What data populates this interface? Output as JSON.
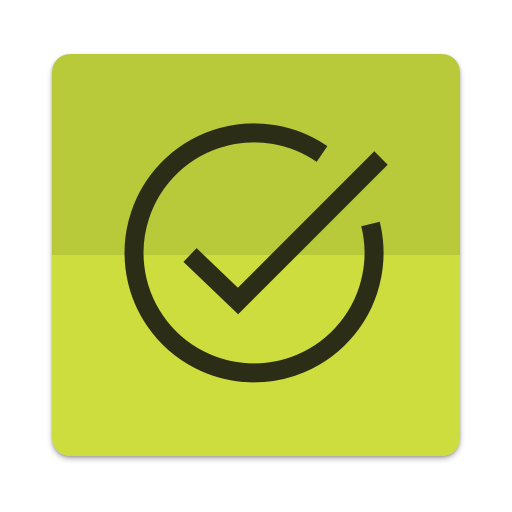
{
  "app_icon": {
    "icon_name": "check-circle-icon",
    "colors": {
      "background_top": "#b8c93a",
      "background_bottom": "#cedd3e",
      "glyph": "#2b2d17"
    }
  }
}
